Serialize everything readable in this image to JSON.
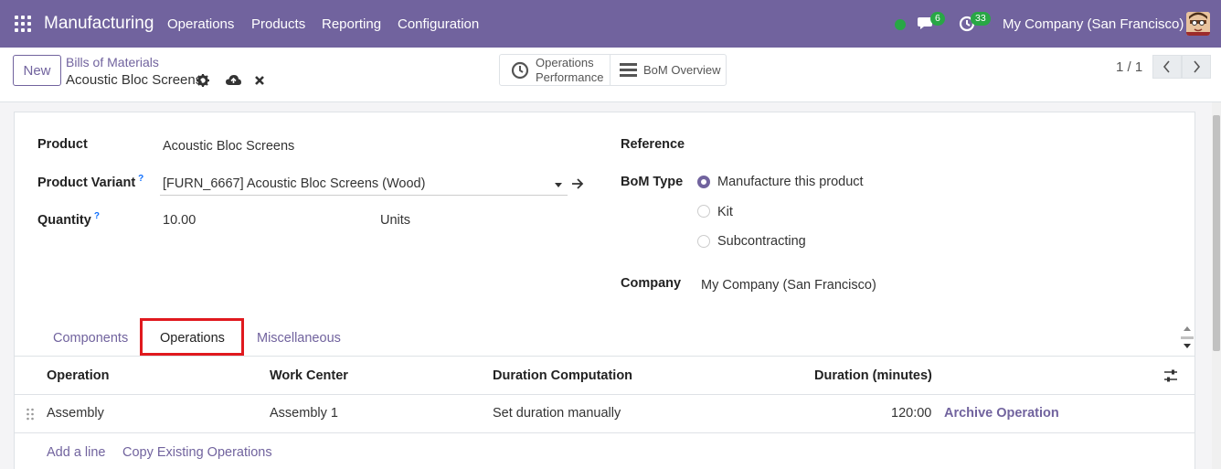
{
  "navbar": {
    "app_name": "Manufacturing",
    "menu": [
      "Operations",
      "Products",
      "Reporting",
      "Configuration"
    ],
    "messages_count": "6",
    "activities_count": "33",
    "company": "My Company (San Francisco)"
  },
  "control": {
    "new_label": "New",
    "breadcrumb_parent": "Bills of Materials",
    "breadcrumb_current": "Acoustic Bloc Screens",
    "smart_ops_line1": "Operations",
    "smart_ops_line2": "Performance",
    "smart_bom_label": "BoM Overview",
    "pager": "1 / 1"
  },
  "form": {
    "product_label": "Product",
    "product_value": "Acoustic Bloc Screens",
    "variant_label": "Product Variant",
    "variant_value": "[FURN_6667] Acoustic Bloc Screens (Wood)",
    "quantity_label": "Quantity",
    "quantity_value": "10.00",
    "quantity_uom": "Units",
    "help_mark": "?",
    "reference_label": "Reference",
    "bom_type_label": "BoM Type",
    "bom_type_options": [
      "Manufacture this product",
      "Kit",
      "Subcontracting"
    ],
    "bom_type_selected": "Manufacture this product",
    "company_label": "Company",
    "company_value": "My Company (San Francisco)"
  },
  "tabs": [
    "Components",
    "Operations",
    "Miscellaneous"
  ],
  "active_tab": "Operations",
  "table": {
    "headers": [
      "Operation",
      "Work Center",
      "Duration Computation",
      "Duration (minutes)"
    ],
    "rows": [
      {
        "operation": "Assembly",
        "work_center": "Assembly 1",
        "duration_computation": "Set duration manually",
        "duration": "120:00",
        "action": "Archive Operation"
      }
    ],
    "add_line": "Add a line",
    "copy_ops": "Copy Existing Operations"
  },
  "colors": {
    "brand": "#71639e",
    "status_online": "#28a745",
    "highlight": "#e0191e"
  }
}
